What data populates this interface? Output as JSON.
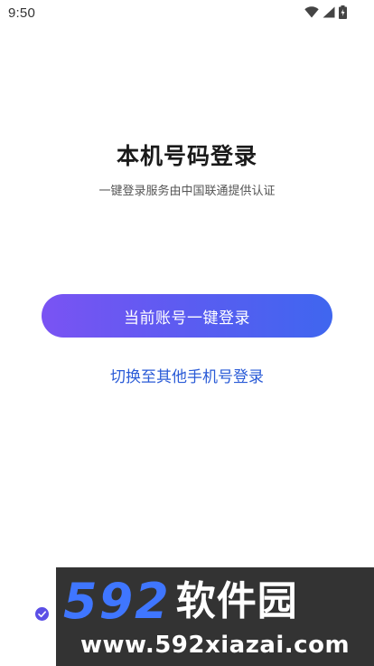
{
  "status_bar": {
    "time": "9:50",
    "icons": [
      "wifi-icon",
      "cell-signal-icon",
      "battery-icon"
    ]
  },
  "login": {
    "title": "本机号码登录",
    "subtitle": "一键登录服务由中国联通提供认证",
    "primary_button_label": "当前账号一键登录",
    "switch_link_label": "切换至其他手机号登录",
    "agreement_checked": true
  },
  "watermark": {
    "brand_number": "592",
    "brand_name": "软件园",
    "url": "www.592xiazai.com"
  },
  "colors": {
    "button_gradient_start": "#7a53f3",
    "button_gradient_end": "#3f66ef",
    "link": "#2a5bd7",
    "check": "#5b4fe6",
    "watermark_bg": "#333333",
    "watermark_number": "#3f76ff"
  }
}
